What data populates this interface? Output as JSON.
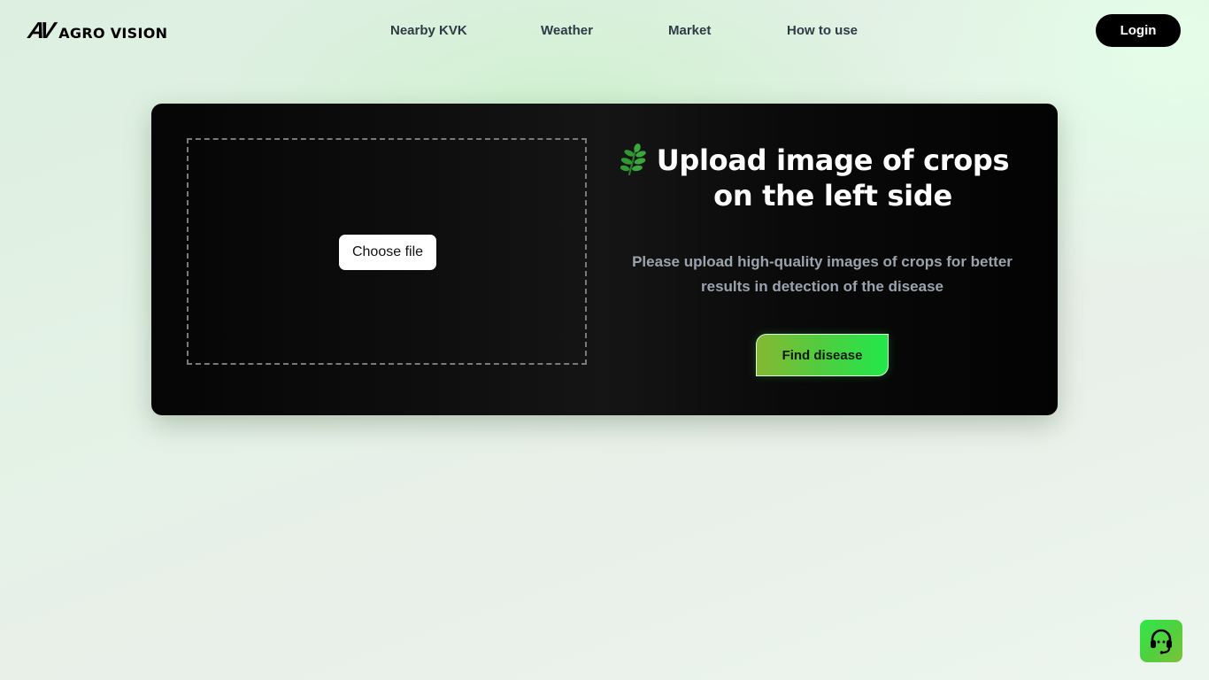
{
  "brand": {
    "mark": "AV",
    "name": "AGRO VISION"
  },
  "nav": {
    "items": [
      {
        "label": "Nearby KVK"
      },
      {
        "label": "Weather"
      },
      {
        "label": "Market"
      },
      {
        "label": "How to use"
      }
    ],
    "login_label": "Login"
  },
  "upload": {
    "choose_file_label": "Choose file",
    "title_line1": "Upload image of crops",
    "title_line2": "on the left side",
    "description": "Please upload high-quality images of crops for better results in detection of the disease",
    "find_button_label": "Find disease",
    "icon": "leaf-icon"
  },
  "support": {
    "icon": "headset-icon"
  },
  "colors": {
    "card_bg": "#0a0a0a",
    "accent_green": "#22e84a",
    "accent_lime": "#86b833",
    "login_bg": "#000000",
    "nav_text": "#2f3a47",
    "subtitle_text": "#9ba3ae"
  }
}
